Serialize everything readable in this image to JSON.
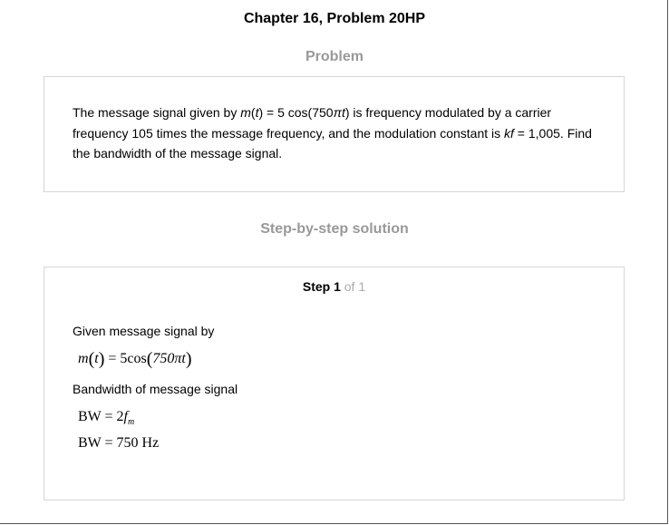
{
  "title": "Chapter 16, Problem 20HP",
  "problem": {
    "heading": "Problem",
    "text_part1": "The message signal given by ",
    "m_var": "m",
    "paren_open": "(",
    "t_var": "t",
    "paren_close": ")",
    "text_part2": " = 5 cos(750",
    "pi_t": "πt",
    "text_part3": ") is frequency modulated by a carrier frequency 105 times the message frequency, and the modulation constant is ",
    "kf": "kf",
    "text_part4": " = 1,005. Find the bandwidth of the message signal."
  },
  "solution": {
    "heading": "Step-by-step solution",
    "step_label": "Step 1",
    "step_of": " of 1",
    "line1": "Given message signal by",
    "eq1": {
      "lhs": "m",
      "arg": "t",
      "rhs": "= 5cos",
      "inner": "750πt"
    },
    "line2": "Bandwidth of message signal",
    "eq2": {
      "lhs": "BW = 2",
      "f": "f",
      "sub": "m"
    },
    "eq3": "BW = 750 Hz"
  }
}
